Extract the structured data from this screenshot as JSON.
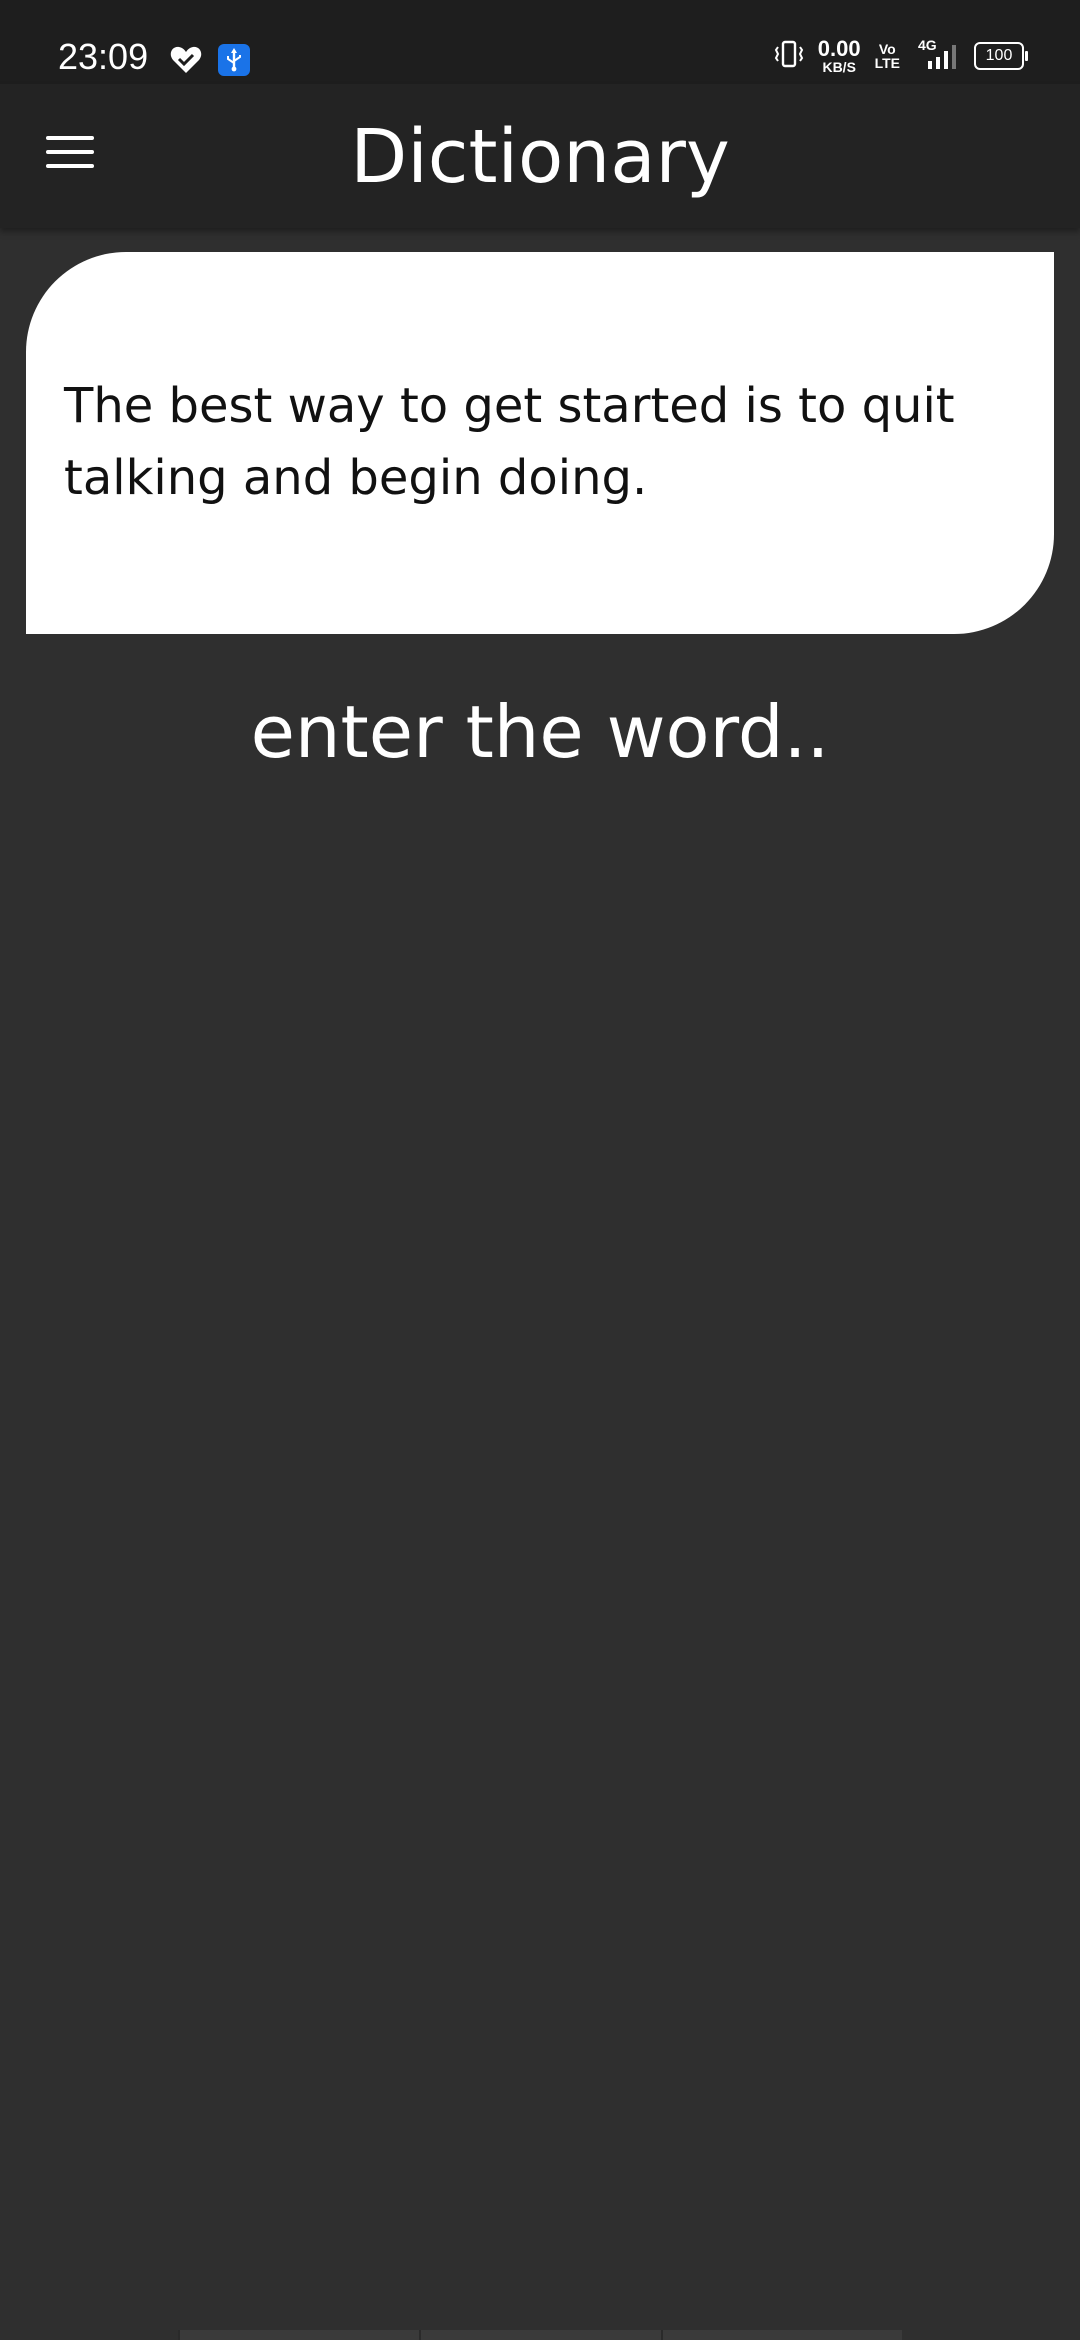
{
  "status_bar": {
    "time": "23:09",
    "net_speed_value": "0.00",
    "net_speed_unit": "KB/S",
    "volte_top": "Vo",
    "volte_bottom": "LTE",
    "network_type": "4G",
    "battery": "100",
    "icons": [
      "heart-check-icon",
      "usb-icon",
      "vibrate-icon",
      "signal-icon",
      "battery-icon"
    ]
  },
  "app_bar": {
    "title": "Dictionary",
    "menu_icon": "hamburger-menu-icon"
  },
  "quote": {
    "text": "The best way to get started is to quit talking and begin doing."
  },
  "search": {
    "placeholder": "enter the word.."
  },
  "colors": {
    "background": "#2f2f2f",
    "app_bar": "#232323",
    "status_bar": "#1e1e1e",
    "card": "#ffffff",
    "usb_badge": "#1a73e8"
  }
}
